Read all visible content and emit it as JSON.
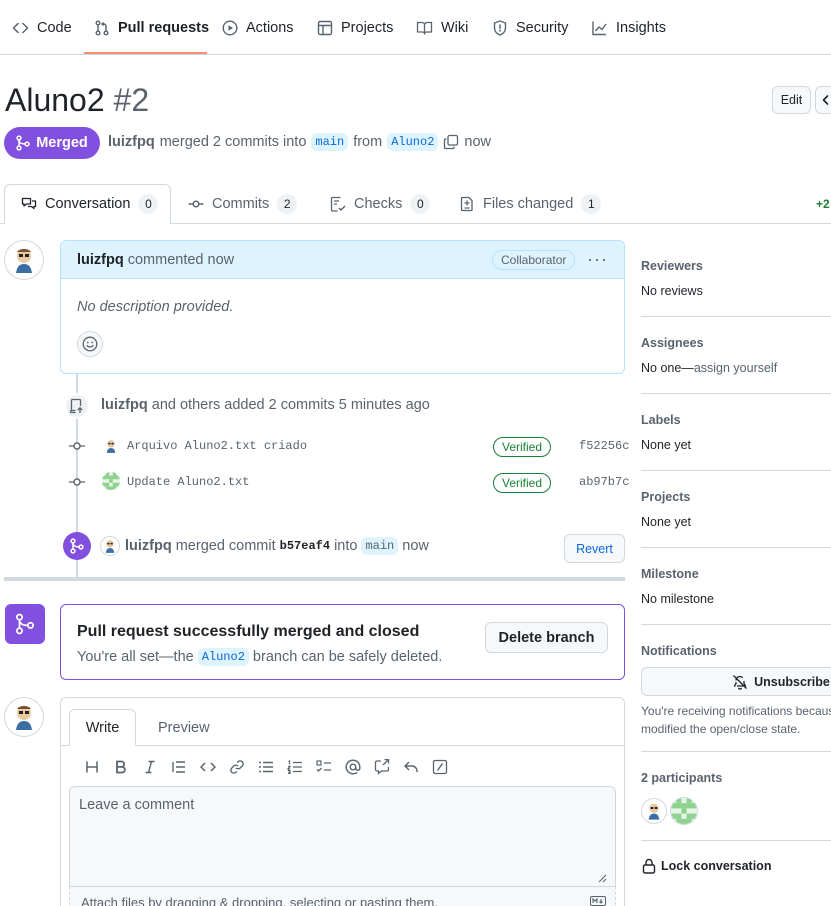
{
  "nav": {
    "items": [
      {
        "label": "Code",
        "icon": "code-icon"
      },
      {
        "label": "Pull requests",
        "icon": "git-pull-request-icon"
      },
      {
        "label": "Actions",
        "icon": "play-icon"
      },
      {
        "label": "Projects",
        "icon": "table-icon"
      },
      {
        "label": "Wiki",
        "icon": "book-icon"
      },
      {
        "label": "Security",
        "icon": "shield-icon"
      },
      {
        "label": "Insights",
        "icon": "graph-icon"
      }
    ]
  },
  "pr": {
    "title": "Aluno2",
    "number": "#2",
    "edit_label": "Edit",
    "state": "Merged",
    "author": "luizfpq",
    "merged_text": "merged 2 commits into",
    "base_branch": "main",
    "from_text": "from",
    "head_branch": "Aluno2",
    "time": "now"
  },
  "tabs": [
    {
      "label": "Conversation",
      "count": "0"
    },
    {
      "label": "Commits",
      "count": "2"
    },
    {
      "label": "Checks",
      "count": "0"
    },
    {
      "label": "Files changed",
      "count": "1"
    }
  ],
  "diffstat": "+2",
  "comment": {
    "author": "luizfpq",
    "action": "commented now",
    "badge": "Collaborator",
    "more": "···",
    "body": "No description provided."
  },
  "commits_event": {
    "author": "luizfpq",
    "text": "and others added 2 commits 5 minutes ago",
    "commits": [
      {
        "message": "Arquivo Aluno2.txt criado",
        "verified": "Verified",
        "sha": "f52256c"
      },
      {
        "message": "Update Aluno2.txt",
        "verified": "Verified",
        "sha": "ab97b7c"
      }
    ]
  },
  "merge_event": {
    "author": "luizfpq",
    "text1": "merged commit",
    "sha": "b57eaf4",
    "text2": "into",
    "branch": "main",
    "time": "now",
    "revert_label": "Revert"
  },
  "merge_box": {
    "title": "Pull request successfully merged and closed",
    "desc_prefix": "You're all set—the",
    "branch": "Aluno2",
    "desc_suffix": "branch can be safely deleted.",
    "delete_label": "Delete branch"
  },
  "editor": {
    "tab_write": "Write",
    "tab_preview": "Preview",
    "placeholder": "Leave a comment",
    "attach_text": "Attach files by dragging & dropping, selecting or pasting them.",
    "tools": [
      "heading-icon",
      "bold-icon",
      "italic-icon",
      "quote-icon",
      "code-icon",
      "link-icon",
      "unordered-list-icon",
      "ordered-list-icon",
      "task-list-icon",
      "mention-icon",
      "cross-reference-icon",
      "reply-icon",
      "slash-commands-icon"
    ]
  },
  "sidebar": {
    "reviewers_title": "Reviewers",
    "reviewers_value": "No reviews",
    "assignees_title": "Assignees",
    "assignees_value": "No one—",
    "assignees_link": "assign yourself",
    "labels_title": "Labels",
    "labels_value": "None yet",
    "projects_title": "Projects",
    "projects_value": "None yet",
    "milestone_title": "Milestone",
    "milestone_value": "No milestone",
    "notifications_title": "Notifications",
    "unsubscribe_label": "Unsubscribe",
    "notifications_note_line1": "You're receiving notifications becaus",
    "notifications_note_line2": "modified the open/close state.",
    "participants_title": "2 participants",
    "lock_label": "Lock conversation"
  },
  "colors": {
    "merged_purple": "#8250df",
    "accent_blue": "#0969da",
    "verified_green": "#1a7f37",
    "nav_underline": "#fd8c73"
  }
}
